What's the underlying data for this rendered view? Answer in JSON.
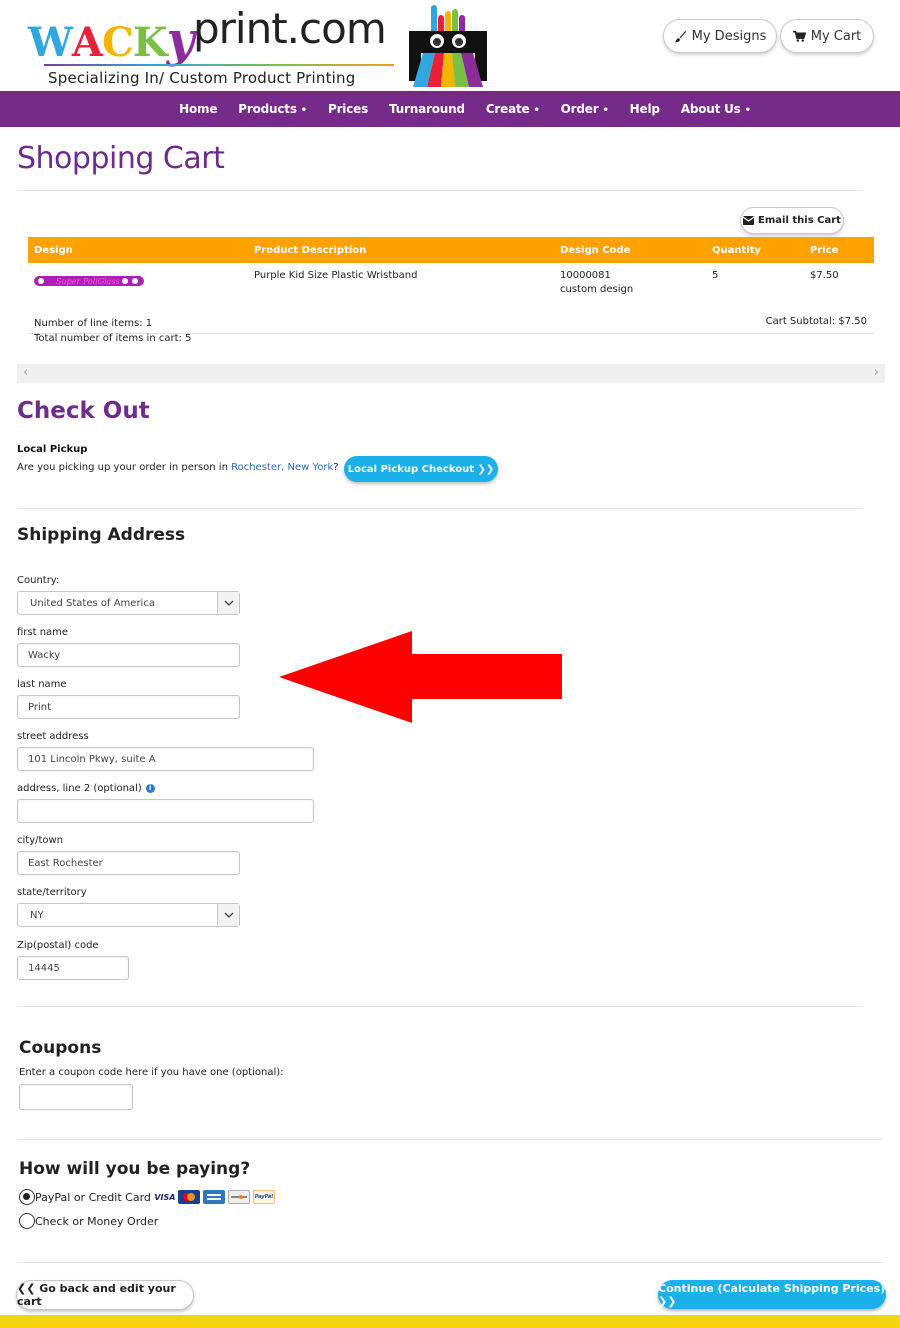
{
  "header": {
    "logo": {
      "letters": [
        {
          "char": "W",
          "color": "#2fa8e0"
        },
        {
          "char": "A",
          "color": "#e8203a"
        },
        {
          "char": "C",
          "color": "#f5b400"
        },
        {
          "char": "K",
          "color": "#7ac143"
        },
        {
          "char": "y",
          "color": "#8a2d9a"
        }
      ],
      "print": "print.com",
      "tagline": "Specializing In/ Custom Product Printing"
    },
    "my_designs_label": "My Designs",
    "my_cart_label": "My Cart"
  },
  "nav": {
    "items": [
      {
        "label": "Home",
        "dropdown": false
      },
      {
        "label": "Products",
        "dropdown": true
      },
      {
        "label": "Prices",
        "dropdown": false
      },
      {
        "label": "Turnaround",
        "dropdown": false
      },
      {
        "label": "Create",
        "dropdown": true
      },
      {
        "label": "Order",
        "dropdown": true
      },
      {
        "label": "Help",
        "dropdown": false
      },
      {
        "label": "About Us",
        "dropdown": true
      }
    ],
    "dropdown_marker": "•"
  },
  "cart": {
    "title": "Shopping Cart",
    "email_label": "Email this Cart",
    "columns": [
      "Design",
      "Product Description",
      "Design Code",
      "Quantity",
      "Price"
    ],
    "rows": [
      {
        "design_text": "Super PoliGlass",
        "description": "Purple Kid Size Plastic Wristband",
        "code": "10000081",
        "code_note": "custom design",
        "quantity": "5",
        "price": "$7.50"
      }
    ],
    "line_items": "Number of line items: 1",
    "total_items": "Total number of items in cart: 5",
    "subtotal": "Cart Subtotal: $7.50"
  },
  "checkout": {
    "title": "Check Out",
    "local_pickup": {
      "heading": "Local Pickup",
      "question_prefix": "Are you picking up your order in person in ",
      "location_link": "Rochester, New York",
      "question_suffix": "?",
      "button_label": "Local Pickup Checkout ❯❯"
    }
  },
  "shipping": {
    "title": "Shipping Address",
    "country_label": "Country:",
    "country_value": "United States of America",
    "first_name_label": "first name",
    "first_name_value": "Wacky",
    "last_name_label": "last name",
    "last_name_value": "Print",
    "street_label": "street address",
    "street_value": "101 Lincoln Pkwy, suite A",
    "address2_label": "address, line 2 (optional)",
    "address2_value": "",
    "city_label": "city/town",
    "city_value": "East Rochester",
    "state_label": "state/territory",
    "state_value": "NY",
    "zip_label": "Zip(postal) code",
    "zip_value": "14445"
  },
  "coupons": {
    "title": "Coupons",
    "prompt": "Enter a coupon code here if you have one (optional):",
    "value": ""
  },
  "payment": {
    "title": "How will you be paying?",
    "options": [
      {
        "label": "PayPal or Credit Card",
        "selected": true
      },
      {
        "label": "Check or Money Order",
        "selected": false
      }
    ],
    "cards": [
      "VISA",
      "MasterCard",
      "AmEx",
      "Discover",
      "PayPal"
    ]
  },
  "footer": {
    "back_label": "❮❮ Go back and edit your cart",
    "continue_label": "Continue (Calculate Shipping Prices) ❯❯"
  },
  "colors": {
    "brand_purple": "#762a8a",
    "title_purple": "#6f2c8f",
    "table_header_orange": "#ffa200",
    "cta_blue": "#1ab0ea",
    "footer_yellow": "#f7d40e",
    "annotation_red": "#ff0000"
  }
}
